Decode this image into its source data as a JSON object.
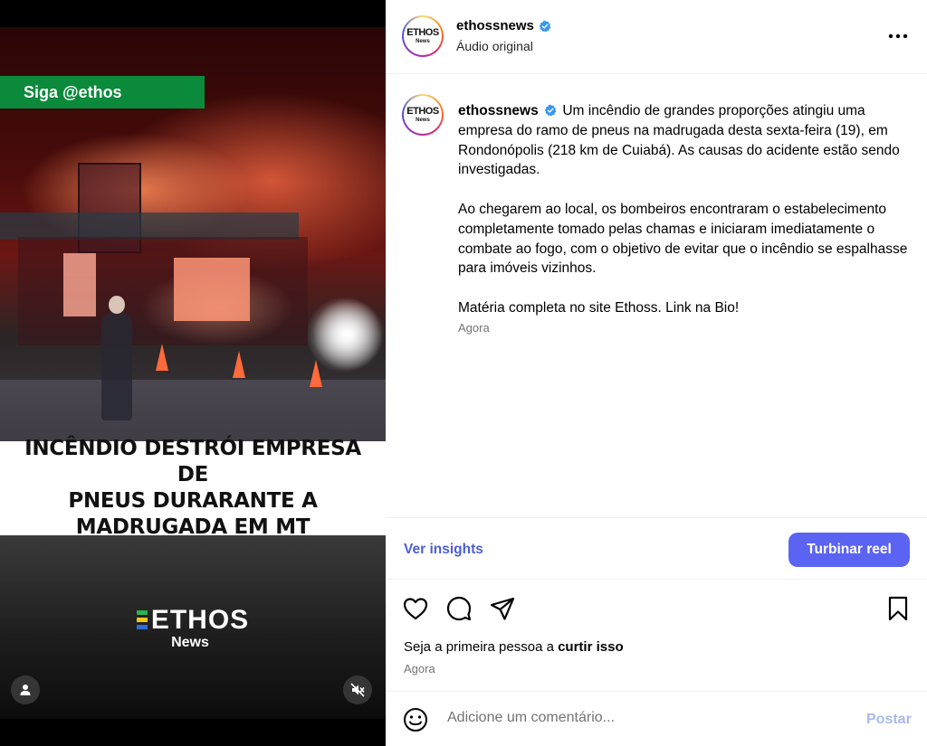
{
  "video": {
    "follow_tag": "Siga @ethos",
    "headline": "INCÊNDIO DESTRÓI EMPRESA DE\nPNEUS DURARANTE A\nMADRUGADA EM MT",
    "brand_name": "ETHOS",
    "brand_sub": "News",
    "brand_bar_colors": [
      "#2bb24c",
      "#f2c518",
      "#2d6bd8"
    ],
    "user_icon": "user-tag-icon",
    "mute_icon": "muted-speaker-icon"
  },
  "header": {
    "username": "ethossnews",
    "subtitle": "Áudio original",
    "avatar_line1": "ETHOS",
    "avatar_line2": "News",
    "more_icon": "more-options-icon"
  },
  "caption": {
    "username": "ethossnews",
    "paragraph1": "Um incêndio de grandes proporções atingiu uma empresa do ramo de pneus na madrugada desta sexta-feira (19), em Rondonópolis (218 km de Cuiabá). As causas do acidente estão sendo investigadas.",
    "paragraph2": "Ao chegarem ao local, os bombeiros encontraram o estabelecimento completamente tomado pelas chamas e iniciaram imediatamente o combate ao fogo, com o objetivo de evitar que o incêndio se espalhasse para imóveis vizinhos.",
    "paragraph3": "Matéria completa no site Ethoss. Link na Bio!",
    "time": "Agora"
  },
  "insights": {
    "link_label": "Ver insights",
    "boost_label": "Turbinar reel"
  },
  "engagement": {
    "likes_prefix": "Seja a primeira pessoa a ",
    "likes_action": "curtir isso",
    "time": "Agora"
  },
  "comment": {
    "placeholder": "Adicione um comentário...",
    "post_label": "Postar"
  },
  "colors": {
    "accent": "#5b63f3",
    "link": "#4a5ed6",
    "verified": "#3897f0",
    "follow_tag_bg": "#0b8a3b"
  }
}
